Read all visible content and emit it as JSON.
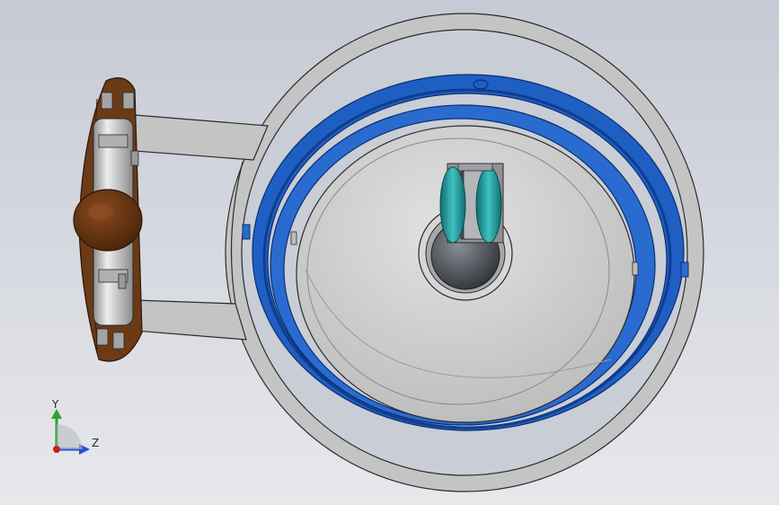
{
  "viewport": {
    "background_top": "#c9cdd6",
    "background_bottom": "#e6e8ec",
    "colors": {
      "frame_gray": "#c4c4c4",
      "edge": "#2b2b2b",
      "blue_ring": "#1f5fc4",
      "blue_ring_dark": "#0f3e8f",
      "disc": "#d2d2d2",
      "hub": "#555a60",
      "teal": "#1f9a9a",
      "brown": "#6b3a17",
      "shaft": "#c8c8c8"
    }
  },
  "triad": {
    "y_label": "Y",
    "z_label": "Z",
    "y_color": "#2fa32f",
    "z_color": "#2a4fd6",
    "origin_color": "#c42020",
    "icon": "coordinate-triad-icon"
  }
}
